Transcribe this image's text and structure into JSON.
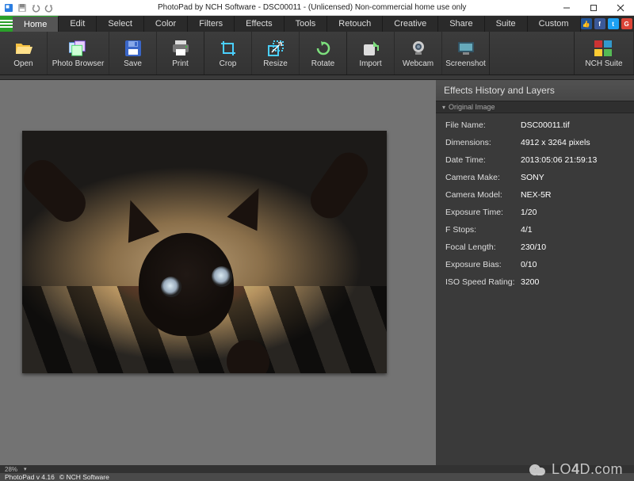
{
  "window": {
    "title": "PhotoPad by NCH Software - DSC00011 - (Unlicensed) Non-commercial home use only"
  },
  "menubar": {
    "tabs": [
      "Home",
      "Edit",
      "Select",
      "Color",
      "Filters",
      "Effects",
      "Tools",
      "Retouch",
      "Creative",
      "Share",
      "Suite",
      "Custom"
    ],
    "active_index": 0
  },
  "toolbar": {
    "items": [
      {
        "label": "Open"
      },
      {
        "label": "Photo Browser"
      },
      {
        "label": "Save"
      },
      {
        "label": "Print"
      },
      {
        "label": "Crop"
      },
      {
        "label": "Resize"
      },
      {
        "label": "Rotate"
      },
      {
        "label": "Import"
      },
      {
        "label": "Webcam"
      },
      {
        "label": "Screenshot"
      }
    ],
    "suite_label": "NCH Suite"
  },
  "sidepanel": {
    "title": "Effects History and Layers",
    "subheader": "Original Image",
    "metadata": [
      {
        "key": "File Name:",
        "value": "DSC00011.tif"
      },
      {
        "key": "Dimensions:",
        "value": "4912 x 3264 pixels"
      },
      {
        "key": "Date Time:",
        "value": "2013:05:06 21:59:13"
      },
      {
        "key": "Camera Make:",
        "value": "SONY"
      },
      {
        "key": "Camera Model:",
        "value": "NEX-5R"
      },
      {
        "key": "Exposure Time:",
        "value": "1/20"
      },
      {
        "key": "F Stops:",
        "value": "4/1"
      },
      {
        "key": "Focal Length:",
        "value": "230/10"
      },
      {
        "key": "Exposure Bias:",
        "value": "0/10"
      },
      {
        "key": "ISO Speed Rating:",
        "value": "3200"
      }
    ]
  },
  "statusbar": {
    "zoom": "28%"
  },
  "footer": {
    "version": "PhotoPad v 4.16",
    "copyright": "© NCH Software"
  },
  "watermark": {
    "text_prefix": "LO",
    "text_bold": "4",
    "text_suffix": "D.com"
  }
}
